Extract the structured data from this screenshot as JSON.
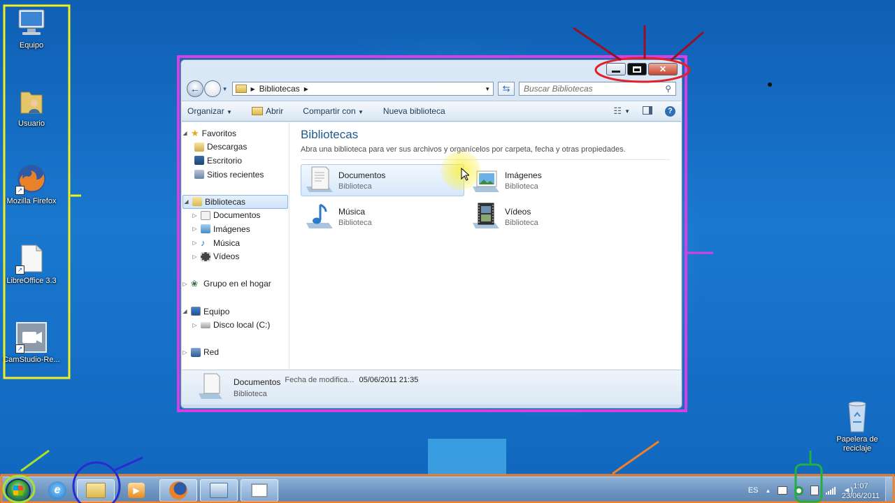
{
  "desktop": {
    "icons": [
      {
        "label": "Equipo",
        "icon": "computer-icon"
      },
      {
        "label": "Usuario",
        "icon": "user-folder-icon"
      },
      {
        "label": "Mozilla Firefox",
        "icon": "firefox-icon"
      },
      {
        "label": "LibreOffice 3.3",
        "icon": "document-icon"
      },
      {
        "label": "CamStudio-Re...",
        "icon": "camera-icon"
      }
    ],
    "recycle_bin": {
      "label": "Papelera de reciclaje",
      "icon": "recycle-bin-icon"
    }
  },
  "window": {
    "address": {
      "root": "Bibliotecas"
    },
    "search_placeholder": "Buscar Bibliotecas",
    "toolbar": {
      "organize": "Organizar",
      "open": "Abrir",
      "share": "Compartir con",
      "new_library": "Nueva biblioteca"
    },
    "nav": {
      "favorites": "Favoritos",
      "downloads": "Descargas",
      "desktop": "Escritorio",
      "recent": "Sitios recientes",
      "libraries": "Bibliotecas",
      "docs": "Documentos",
      "images": "Imágenes",
      "music": "Música",
      "videos": "Vídeos",
      "homegroup": "Grupo en el hogar",
      "computer": "Equipo",
      "local_disk": "Disco local (C:)",
      "network": "Red"
    },
    "main": {
      "title": "Bibliotecas",
      "subtitle": "Abra una biblioteca para ver sus archivos y organícelos por carpeta, fecha y otras propiedades.",
      "libraries": [
        {
          "name": "Documentos",
          "kind": "Biblioteca"
        },
        {
          "name": "Imágenes",
          "kind": "Biblioteca"
        },
        {
          "name": "Música",
          "kind": "Biblioteca"
        },
        {
          "name": "Vídeos",
          "kind": "Biblioteca"
        }
      ]
    },
    "details": {
      "name": "Documentos",
      "kind": "Biblioteca",
      "modified_label": "Fecha de modifica...",
      "modified_value": "05/06/2011 21:35"
    }
  },
  "taskbar": {
    "language": "ES",
    "time": "1:07",
    "date": "23/06/2011"
  },
  "colors": {
    "annotation_yellow": "#f0f020",
    "annotation_magenta": "#d63fe0",
    "annotation_red": "#e0202a",
    "annotation_darkred": "#9a1020",
    "annotation_blue": "#2a2ad0",
    "annotation_orange": "#f0802a",
    "annotation_green": "#20b040",
    "annotation_lime": "#a8e030"
  }
}
